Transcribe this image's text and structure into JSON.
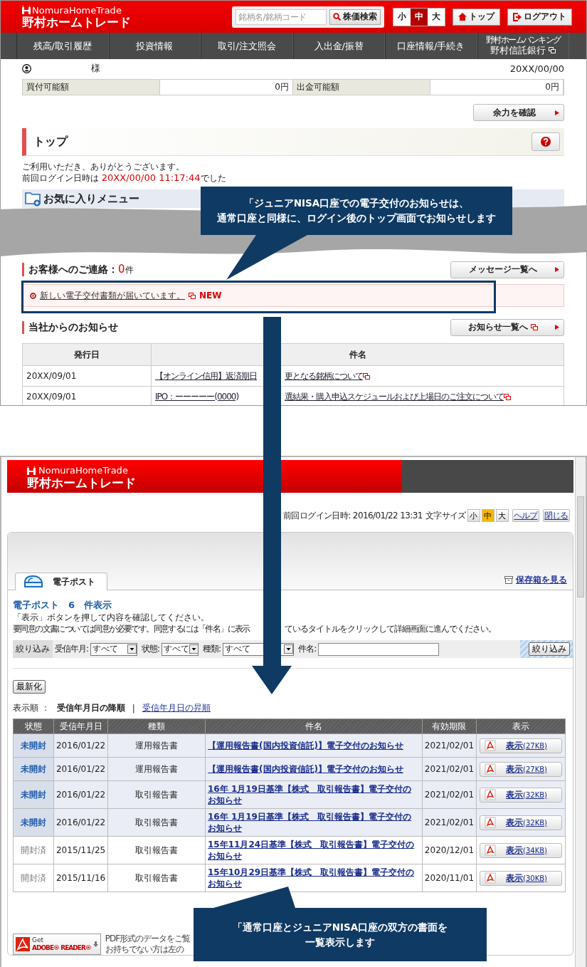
{
  "top_screen": {
    "logo": {
      "en": "NomuraHomeTrade",
      "ja": "野村ホームトレード"
    },
    "search": {
      "placeholder": "銘柄名/銘柄コード",
      "button": "株価検索"
    },
    "font_sizes": [
      {
        "label": "小",
        "selected": false
      },
      {
        "label": "中",
        "selected": true
      },
      {
        "label": "大",
        "selected": false
      }
    ],
    "header_buttons": [
      {
        "kind": "home",
        "label": "トップ"
      },
      {
        "kind": "logout",
        "label": "ログアウト"
      }
    ],
    "nav": [
      {
        "kind": "plain",
        "label": "残高/取引履歴"
      },
      {
        "kind": "plain",
        "label": "投資情報"
      },
      {
        "kind": "plain",
        "label": "取引/注文照会"
      },
      {
        "kind": "plain",
        "label": "入出金/振替"
      },
      {
        "kind": "plain",
        "label": "口座情報/手続き"
      },
      {
        "kind": "bank",
        "caption": "野村ホームバンキング",
        "label": "野村信託銀行"
      }
    ],
    "user_suffix": "様",
    "date": "20XX/00/00",
    "balances": [
      {
        "label": "買付可能額",
        "value": "0円"
      },
      {
        "label": "出金可能額",
        "value": "0円"
      }
    ],
    "check_button": "余力を確認",
    "page_title": "トップ",
    "greeting": "ご利用いただき、ありがとうございます。",
    "last_login": {
      "label": "前回ログイン日時は",
      "value": "20XX/00/00 11:17:44",
      "suffix": "でした"
    },
    "favorites_title": "お気に入りメニュー",
    "contact": {
      "title": "お客様へのご連絡：",
      "count": "0",
      "unit": "件",
      "button": "メッセージ一覧へ",
      "message": "新しい電子交付書類が届いています。",
      "badge": "NEW"
    },
    "notices": {
      "title": "当社からのお知らせ",
      "button": "お知らせ一覧へ",
      "columns": [
        "発行日",
        "件名"
      ],
      "rows": [
        {
          "date": "20XX/09/01",
          "subject_parts": [
            "【オンライン信用】返済期日",
            "更となる銘柄について"
          ]
        },
        {
          "date": "20XX/09/01",
          "subject_parts": [
            "IPO：ーーーーー(0000)",
            "選結果・購入申込スケジュールおよび上場日のご注文について"
          ]
        }
      ]
    }
  },
  "post_screen": {
    "logo": {
      "en": "NomuraHomeTrade",
      "ja": "野村ホームトレード"
    },
    "last_login": "前回ログイン日時: 2016/01/22 13:31",
    "font_size_label": "文字サイズ",
    "font_sizes": [
      {
        "label": "小",
        "selected": false
      },
      {
        "label": "中",
        "selected": true
      },
      {
        "label": "大",
        "selected": false
      }
    ],
    "buttons": [
      "ヘルプ",
      "閉じる"
    ],
    "tabs": [
      {
        "label": "電子ポスト",
        "selected": true
      }
    ],
    "archive_link": "保存箱を見る",
    "title": "電子ポスト　6　件表示",
    "instructions": [
      {
        "parts": [
          "「表示」ボタンを押して内容を確認してください。"
        ]
      },
      {
        "parts": [
          "要同意の文書については同意が必要です。同意するには「件名」に表示",
          "ているタイトルをクリックして詳細画面に進んでください。"
        ]
      }
    ],
    "filter": {
      "label": "絞り込み",
      "fields": [
        {
          "kind": "select",
          "label": "受信年月:",
          "value": "すべて"
        },
        {
          "kind": "select",
          "label": "状態:",
          "value": "すべて"
        },
        {
          "kind": "select",
          "label": "種類:",
          "value": "すべて"
        },
        {
          "kind": "text",
          "label": "件名:"
        }
      ],
      "button": "絞り込み"
    },
    "refresh_button": "最新化",
    "sort": {
      "label": "表示順 ：",
      "current": "受信年月日の降順",
      "separator": "|",
      "other": "受信年月日の昇順"
    },
    "table": {
      "columns": [
        "状態",
        "受信年月日",
        "種類",
        "件名",
        "有効期限",
        "表示"
      ],
      "rows": [
        {
          "status": "未開封",
          "opened": false,
          "date": "2016/01/22",
          "type": "運用報告書",
          "subject": "【運用報告書(国内投資信託)】電子交付のお知らせ",
          "expiry": "2021/02/01",
          "view": "表示",
          "size": "(27KB)"
        },
        {
          "status": "未開封",
          "opened": false,
          "date": "2016/01/22",
          "type": "運用報告書",
          "subject": "【運用報告書(国内投資信託)】電子交付のお知らせ",
          "expiry": "2021/02/01",
          "view": "表示",
          "size": "(27KB)"
        },
        {
          "status": "未開封",
          "opened": false,
          "date": "2016/01/22",
          "type": "取引報告書",
          "subject": "16年 1月19日基準【株式　取引報告書】電子交付のお知らせ",
          "expiry": "2021/02/01",
          "view": "表示",
          "size": "(32KB)"
        },
        {
          "status": "未開封",
          "opened": false,
          "date": "2016/01/22",
          "type": "取引報告書",
          "subject": "16年 1月19日基準【株式　取引報告書】電子交付のお知らせ",
          "expiry": "2021/02/01",
          "view": "表示",
          "size": "(32KB)"
        },
        {
          "status": "開封済",
          "opened": true,
          "date": "2015/11/25",
          "type": "取引報告書",
          "subject": "15年11月24日基準【株式　取引報告書】電子交付のお知らせ",
          "expiry": "2020/12/01",
          "view": "表示",
          "size": "(34KB)"
        },
        {
          "status": "開封済",
          "opened": true,
          "date": "2015/11/16",
          "type": "取引報告書",
          "subject": "15年10月29日基準【株式　取引報告書】電子交付のお知らせ",
          "expiry": "2020/11/01",
          "view": "表示",
          "size": "(30KB)"
        }
      ]
    },
    "adobe": {
      "get": "Get",
      "brand": "ADOBE® READER®",
      "note_lines": [
        "PDF形式のデータをご覧",
        "お持ちでない方は左の"
      ]
    }
  },
  "callouts": [
    {
      "lines": [
        "「ジュニアNISA口座での電子交付のお知らせは、",
        "通常口座と同様に、ログイン後のトップ画面でお知らせします"
      ]
    },
    {
      "lines": [
        "「通常口座とジュニアNISA口座の双方の書面を",
        "一覧表示します"
      ]
    }
  ]
}
